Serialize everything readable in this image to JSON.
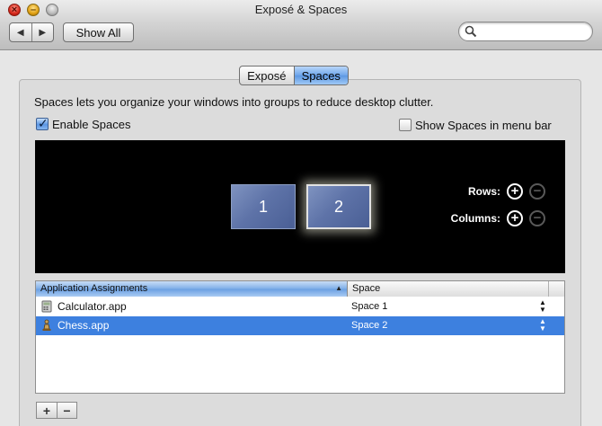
{
  "window": {
    "title": "Exposé & Spaces"
  },
  "toolbar": {
    "back_icon": "back-arrow-icon",
    "forward_icon": "forward-arrow-icon",
    "show_all_label": "Show All",
    "search_placeholder": ""
  },
  "tabs": [
    {
      "label": "Exposé",
      "active": false
    },
    {
      "label": "Spaces",
      "active": true
    }
  ],
  "description": "Spaces lets you organize your windows into groups to reduce desktop clutter.",
  "enable_spaces": {
    "label": "Enable Spaces",
    "checked": true
  },
  "show_in_menu_bar": {
    "label": "Show Spaces in menu bar",
    "checked": false
  },
  "preview": {
    "spaces": [
      "1",
      "2"
    ],
    "selected_space": "2",
    "rows_label": "Rows:",
    "columns_label": "Columns:"
  },
  "assignments": {
    "columns": [
      "Application Assignments",
      "Space"
    ],
    "rows": [
      {
        "app": "Calculator.app",
        "space": "Space 1",
        "icon": "calculator-icon",
        "selected": false
      },
      {
        "app": "Chess.app",
        "space": "Space 2",
        "icon": "chess-icon",
        "selected": true
      }
    ]
  },
  "colors": {
    "selection": "#3d80df",
    "preview_bg": "#000000",
    "space_tile": "#5e73a8"
  }
}
